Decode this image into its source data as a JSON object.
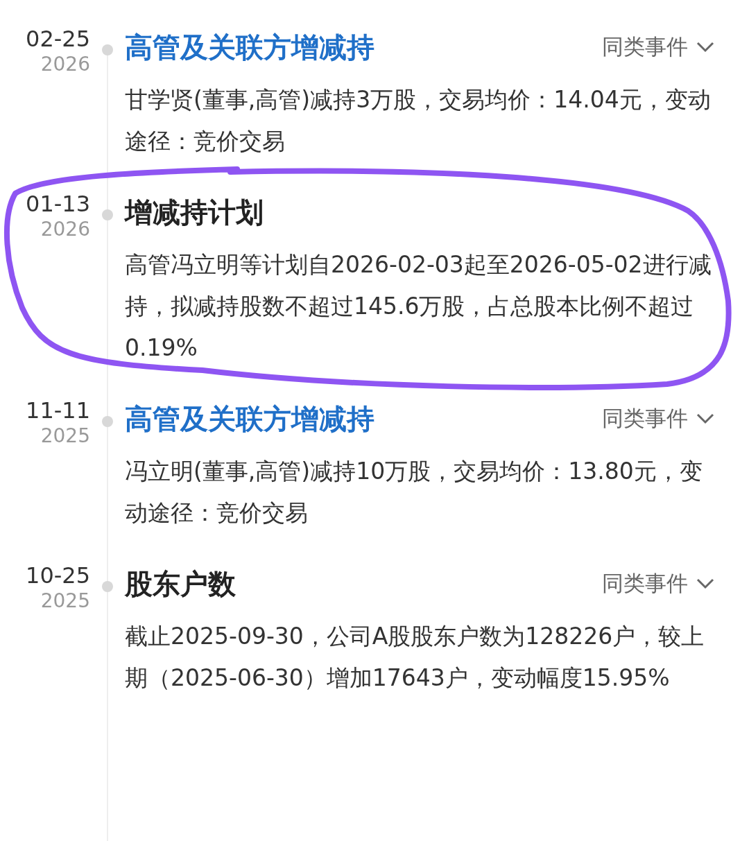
{
  "events": [
    {
      "date": "02-25",
      "year": "2026",
      "title": "高管及关联方增减持",
      "linked": true,
      "similar": "同类事件",
      "body": "甘学贤(董事,高管)减持3万股，交易均价：14.04元，变动途径：竞价交易",
      "highlighted": false
    },
    {
      "date": "01-13",
      "year": "2026",
      "title": "增减持计划",
      "linked": false,
      "body": "高管冯立明等计划自2026-02-03起至2026-05-02进行减持，拟减持股数不超过145.6万股，占总股本比例不超过0.19%",
      "highlighted": true
    },
    {
      "date": "11-11",
      "year": "2025",
      "title": "高管及关联方增减持",
      "linked": true,
      "similar": "同类事件",
      "body": "冯立明(董事,高管)减持10万股，交易均价：13.80元，变动途径：竞价交易",
      "highlighted": false
    },
    {
      "date": "10-25",
      "year": "2025",
      "title": "股东户数",
      "linked": false,
      "similar": "同类事件",
      "body": "截止2025-09-30，公司A股股东户数为128226户，较上期（2025-06-30）增加17643户，变动幅度15.95%",
      "highlighted": false
    }
  ]
}
